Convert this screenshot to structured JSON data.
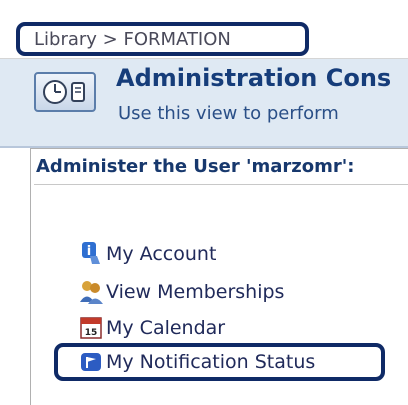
{
  "breadcrumb": {
    "text": "Library > FORMATION"
  },
  "header": {
    "title": "Administration Cons",
    "subtitle": "Use this view to perform"
  },
  "section": {
    "title": "Administer the User 'marzomr':"
  },
  "menu": [
    {
      "label": "My Account",
      "icon": "info-icon"
    },
    {
      "label": "View Memberships",
      "icon": "memberships-icon"
    },
    {
      "label": "My Calendar",
      "icon": "calendar-icon"
    },
    {
      "label": "My Notification Status",
      "icon": "notification-flag-icon"
    }
  ],
  "colors": {
    "highlight_border": "#0f2a66",
    "header_band": "#dfe9f3",
    "title_text": "#163d7a"
  }
}
